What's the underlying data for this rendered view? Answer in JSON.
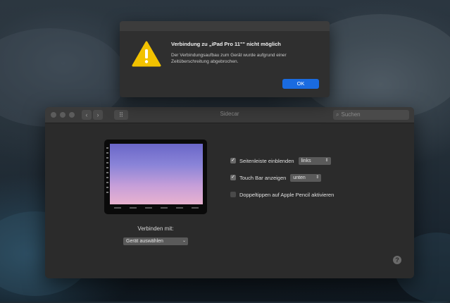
{
  "alert": {
    "title": "Verbindung zu „iPad Pro 11\"\" nicht möglich",
    "message": "Der Verbindungsaufbau zum Gerät wurde aufgrund einer Zeitüberschreitung abgebrochen.",
    "ok_label": "OK",
    "icon": "warning-icon"
  },
  "window": {
    "title": "Sidecar",
    "search_placeholder": "Suchen",
    "back_label": "‹",
    "forward_label": "›",
    "grid_label": "⠿"
  },
  "options": [
    {
      "label": "Seitenleiste einblenden",
      "checked": true,
      "value": "links"
    },
    {
      "label": "Touch Bar anzeigen",
      "checked": true,
      "value": "unten"
    },
    {
      "label": "Doppeltippen auf Apple Pencil aktivieren",
      "checked": false
    }
  ],
  "connect": {
    "label": "Verbinden mit:",
    "device_value": "Gerät auswählen"
  },
  "help_label": "?",
  "colors": {
    "accent": "#1a6be0",
    "window_bg": "#2b2b2b",
    "warning": "#f2c200"
  }
}
